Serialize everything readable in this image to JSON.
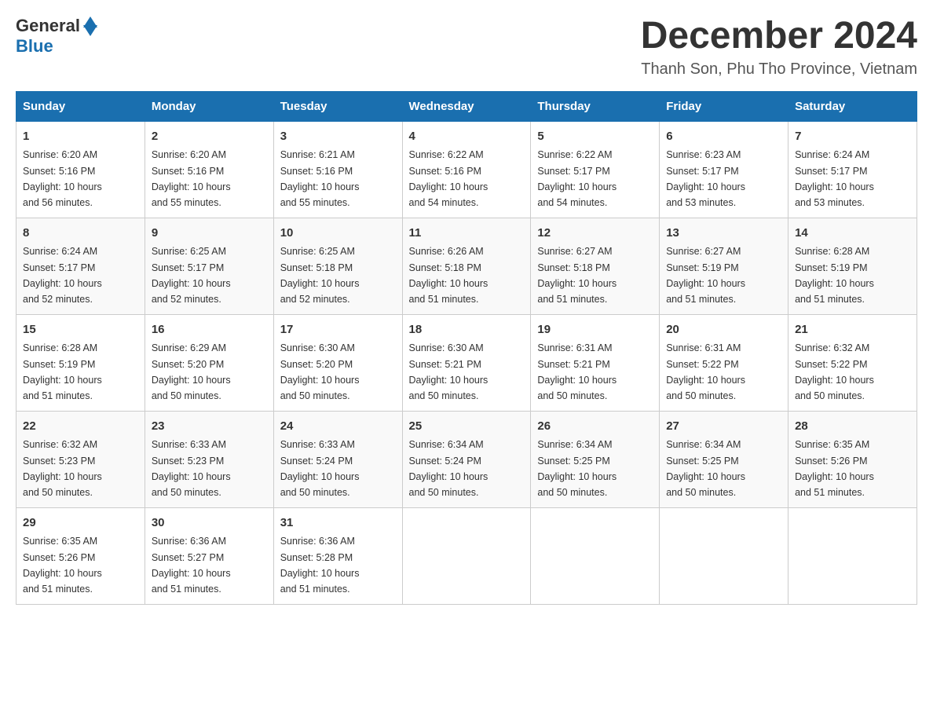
{
  "logo": {
    "general": "General",
    "blue": "Blue"
  },
  "header": {
    "month_year": "December 2024",
    "location": "Thanh Son, Phu Tho Province, Vietnam"
  },
  "days_of_week": [
    "Sunday",
    "Monday",
    "Tuesday",
    "Wednesday",
    "Thursday",
    "Friday",
    "Saturday"
  ],
  "weeks": [
    [
      {
        "day": "1",
        "sunrise": "6:20 AM",
        "sunset": "5:16 PM",
        "daylight": "10 hours and 56 minutes."
      },
      {
        "day": "2",
        "sunrise": "6:20 AM",
        "sunset": "5:16 PM",
        "daylight": "10 hours and 55 minutes."
      },
      {
        "day": "3",
        "sunrise": "6:21 AM",
        "sunset": "5:16 PM",
        "daylight": "10 hours and 55 minutes."
      },
      {
        "day": "4",
        "sunrise": "6:22 AM",
        "sunset": "5:16 PM",
        "daylight": "10 hours and 54 minutes."
      },
      {
        "day": "5",
        "sunrise": "6:22 AM",
        "sunset": "5:17 PM",
        "daylight": "10 hours and 54 minutes."
      },
      {
        "day": "6",
        "sunrise": "6:23 AM",
        "sunset": "5:17 PM",
        "daylight": "10 hours and 53 minutes."
      },
      {
        "day": "7",
        "sunrise": "6:24 AM",
        "sunset": "5:17 PM",
        "daylight": "10 hours and 53 minutes."
      }
    ],
    [
      {
        "day": "8",
        "sunrise": "6:24 AM",
        "sunset": "5:17 PM",
        "daylight": "10 hours and 52 minutes."
      },
      {
        "day": "9",
        "sunrise": "6:25 AM",
        "sunset": "5:17 PM",
        "daylight": "10 hours and 52 minutes."
      },
      {
        "day": "10",
        "sunrise": "6:25 AM",
        "sunset": "5:18 PM",
        "daylight": "10 hours and 52 minutes."
      },
      {
        "day": "11",
        "sunrise": "6:26 AM",
        "sunset": "5:18 PM",
        "daylight": "10 hours and 51 minutes."
      },
      {
        "day": "12",
        "sunrise": "6:27 AM",
        "sunset": "5:18 PM",
        "daylight": "10 hours and 51 minutes."
      },
      {
        "day": "13",
        "sunrise": "6:27 AM",
        "sunset": "5:19 PM",
        "daylight": "10 hours and 51 minutes."
      },
      {
        "day": "14",
        "sunrise": "6:28 AM",
        "sunset": "5:19 PM",
        "daylight": "10 hours and 51 minutes."
      }
    ],
    [
      {
        "day": "15",
        "sunrise": "6:28 AM",
        "sunset": "5:19 PM",
        "daylight": "10 hours and 51 minutes."
      },
      {
        "day": "16",
        "sunrise": "6:29 AM",
        "sunset": "5:20 PM",
        "daylight": "10 hours and 50 minutes."
      },
      {
        "day": "17",
        "sunrise": "6:30 AM",
        "sunset": "5:20 PM",
        "daylight": "10 hours and 50 minutes."
      },
      {
        "day": "18",
        "sunrise": "6:30 AM",
        "sunset": "5:21 PM",
        "daylight": "10 hours and 50 minutes."
      },
      {
        "day": "19",
        "sunrise": "6:31 AM",
        "sunset": "5:21 PM",
        "daylight": "10 hours and 50 minutes."
      },
      {
        "day": "20",
        "sunrise": "6:31 AM",
        "sunset": "5:22 PM",
        "daylight": "10 hours and 50 minutes."
      },
      {
        "day": "21",
        "sunrise": "6:32 AM",
        "sunset": "5:22 PM",
        "daylight": "10 hours and 50 minutes."
      }
    ],
    [
      {
        "day": "22",
        "sunrise": "6:32 AM",
        "sunset": "5:23 PM",
        "daylight": "10 hours and 50 minutes."
      },
      {
        "day": "23",
        "sunrise": "6:33 AM",
        "sunset": "5:23 PM",
        "daylight": "10 hours and 50 minutes."
      },
      {
        "day": "24",
        "sunrise": "6:33 AM",
        "sunset": "5:24 PM",
        "daylight": "10 hours and 50 minutes."
      },
      {
        "day": "25",
        "sunrise": "6:34 AM",
        "sunset": "5:24 PM",
        "daylight": "10 hours and 50 minutes."
      },
      {
        "day": "26",
        "sunrise": "6:34 AM",
        "sunset": "5:25 PM",
        "daylight": "10 hours and 50 minutes."
      },
      {
        "day": "27",
        "sunrise": "6:34 AM",
        "sunset": "5:25 PM",
        "daylight": "10 hours and 50 minutes."
      },
      {
        "day": "28",
        "sunrise": "6:35 AM",
        "sunset": "5:26 PM",
        "daylight": "10 hours and 51 minutes."
      }
    ],
    [
      {
        "day": "29",
        "sunrise": "6:35 AM",
        "sunset": "5:26 PM",
        "daylight": "10 hours and 51 minutes."
      },
      {
        "day": "30",
        "sunrise": "6:36 AM",
        "sunset": "5:27 PM",
        "daylight": "10 hours and 51 minutes."
      },
      {
        "day": "31",
        "sunrise": "6:36 AM",
        "sunset": "5:28 PM",
        "daylight": "10 hours and 51 minutes."
      },
      null,
      null,
      null,
      null
    ]
  ],
  "labels": {
    "sunrise": "Sunrise:",
    "sunset": "Sunset:",
    "daylight": "Daylight:"
  }
}
